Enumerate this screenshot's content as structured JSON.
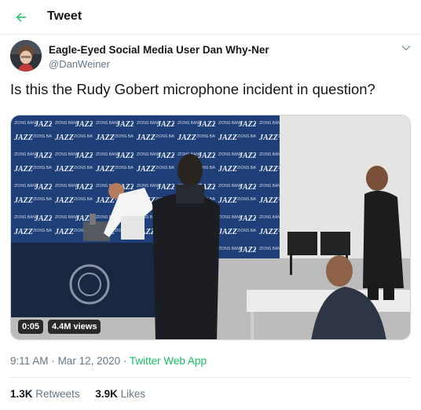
{
  "header": {
    "title": "Tweet",
    "back_icon": "arrow-left-icon",
    "accent_color": "#17bf63"
  },
  "tweet": {
    "author_name": "Eagle-Eyed Social Media User Dan Why-Ner",
    "author_handle": "@DanWeiner",
    "text": "Is this the Rudy Gobert microphone incident in question?",
    "video": {
      "time": "0:05",
      "views": "4.4M views",
      "banner_text": "ZIONS BANK",
      "logo_text": "JAZZ"
    },
    "time": "9:11 AM",
    "separator": "·",
    "date": "Mar 12, 2020",
    "source": "Twitter Web App",
    "retweets_count": "1.3K",
    "retweets_label": "Retweets",
    "likes_count": "3.9K",
    "likes_label": "Likes"
  },
  "colors": {
    "text_primary": "#14171a",
    "text_secondary": "#657786",
    "link_green": "#17bf63",
    "border": "#e6ecf0"
  }
}
